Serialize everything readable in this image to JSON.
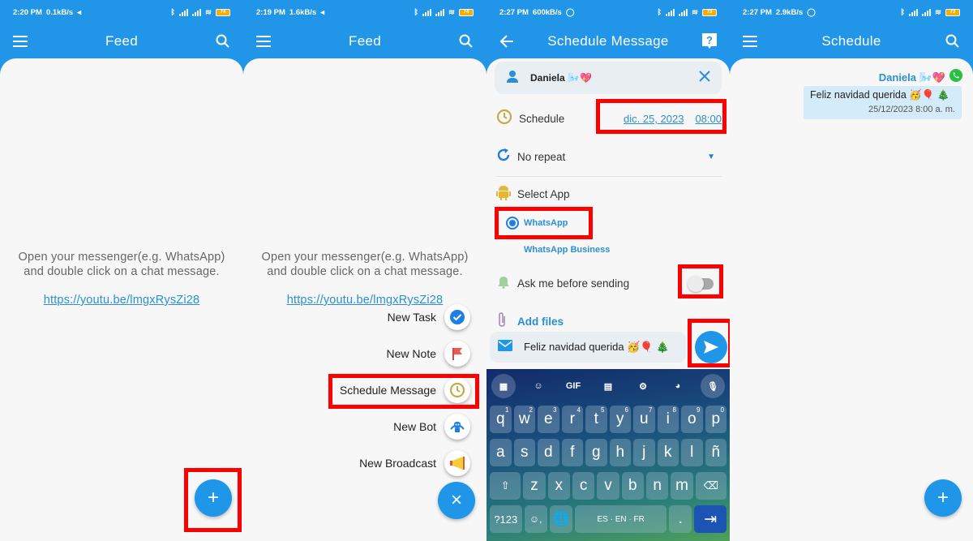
{
  "panels": [
    {
      "status": {
        "time": "2:20 PM",
        "speed": "0.1kB/s",
        "battery": "74"
      },
      "title": "Feed",
      "empty_text_line1": "Open your messenger(e.g. WhatsApp)",
      "empty_text_line2": "and double click on a chat message.",
      "link": "https://youtu.be/lmgxRysZi28",
      "fab": "+"
    },
    {
      "status": {
        "time": "2:19 PM",
        "speed": "1.6kB/s",
        "battery": "74"
      },
      "title": "Feed",
      "empty_text_line1": "Open your messenger(e.g. WhatsApp)",
      "empty_text_line2": "and double click on a chat message.",
      "link": "https://youtu.be/lmgxRysZi28",
      "speed_dial": [
        {
          "label": "New Task",
          "icon": "check-circle-icon"
        },
        {
          "label": "New Note",
          "icon": "flag-icon"
        },
        {
          "label": "Schedule Message",
          "icon": "clock-icon"
        },
        {
          "label": "New Bot",
          "icon": "robot-icon"
        },
        {
          "label": "New Broadcast",
          "icon": "megaphone-icon"
        }
      ],
      "fab": "×"
    },
    {
      "status": {
        "time": "2:27 PM",
        "speed": "600kB/s",
        "battery": "73"
      },
      "title": "Schedule Message",
      "contact": "Daniela 🌬️💖",
      "schedule_label": "Schedule",
      "date": "dic. 25, 2023",
      "time": "08:00",
      "repeat": "No repeat",
      "select_app_label": "Select App",
      "apps": [
        "WhatsApp",
        "WhatsApp Business"
      ],
      "selected_app": "WhatsApp",
      "ask_label": "Ask me before sending",
      "ask_enabled": false,
      "add_files": "Add files",
      "message": "Feliz navidad querida 🥳🎈 🎄",
      "keyboard": {
        "toolbar": [
          "apps",
          "sticker",
          "GIF",
          "clipboard",
          "settings",
          "palette",
          "mic"
        ],
        "row1": [
          [
            "q",
            "1"
          ],
          [
            "w",
            "2"
          ],
          [
            "e",
            "3"
          ],
          [
            "r",
            "4"
          ],
          [
            "t",
            "5"
          ],
          [
            "y",
            "6"
          ],
          [
            "u",
            "7"
          ],
          [
            "i",
            "8"
          ],
          [
            "o",
            "9"
          ],
          [
            "p",
            "0"
          ]
        ],
        "row2": [
          "a",
          "s",
          "d",
          "f",
          "g",
          "h",
          "j",
          "k",
          "l",
          "ñ"
        ],
        "row3": [
          "z",
          "x",
          "c",
          "v",
          "b",
          "n",
          "m"
        ],
        "symbols": "?123",
        "space": "ES · EN · FR",
        "period": "."
      }
    },
    {
      "status": {
        "time": "2:27 PM",
        "speed": "2.9kB/s",
        "battery": "73"
      },
      "title": "Schedule",
      "contact": "Daniela 🌬️💖",
      "message": "Feliz navidad querida 🥳🎈 🎄",
      "datetime": "25/12/2023 8:00 a. m.",
      "fab": "+"
    }
  ],
  "colors": {
    "primary": "#2196e8",
    "highlight": "#ff0000",
    "link": "#2a8fd4"
  }
}
